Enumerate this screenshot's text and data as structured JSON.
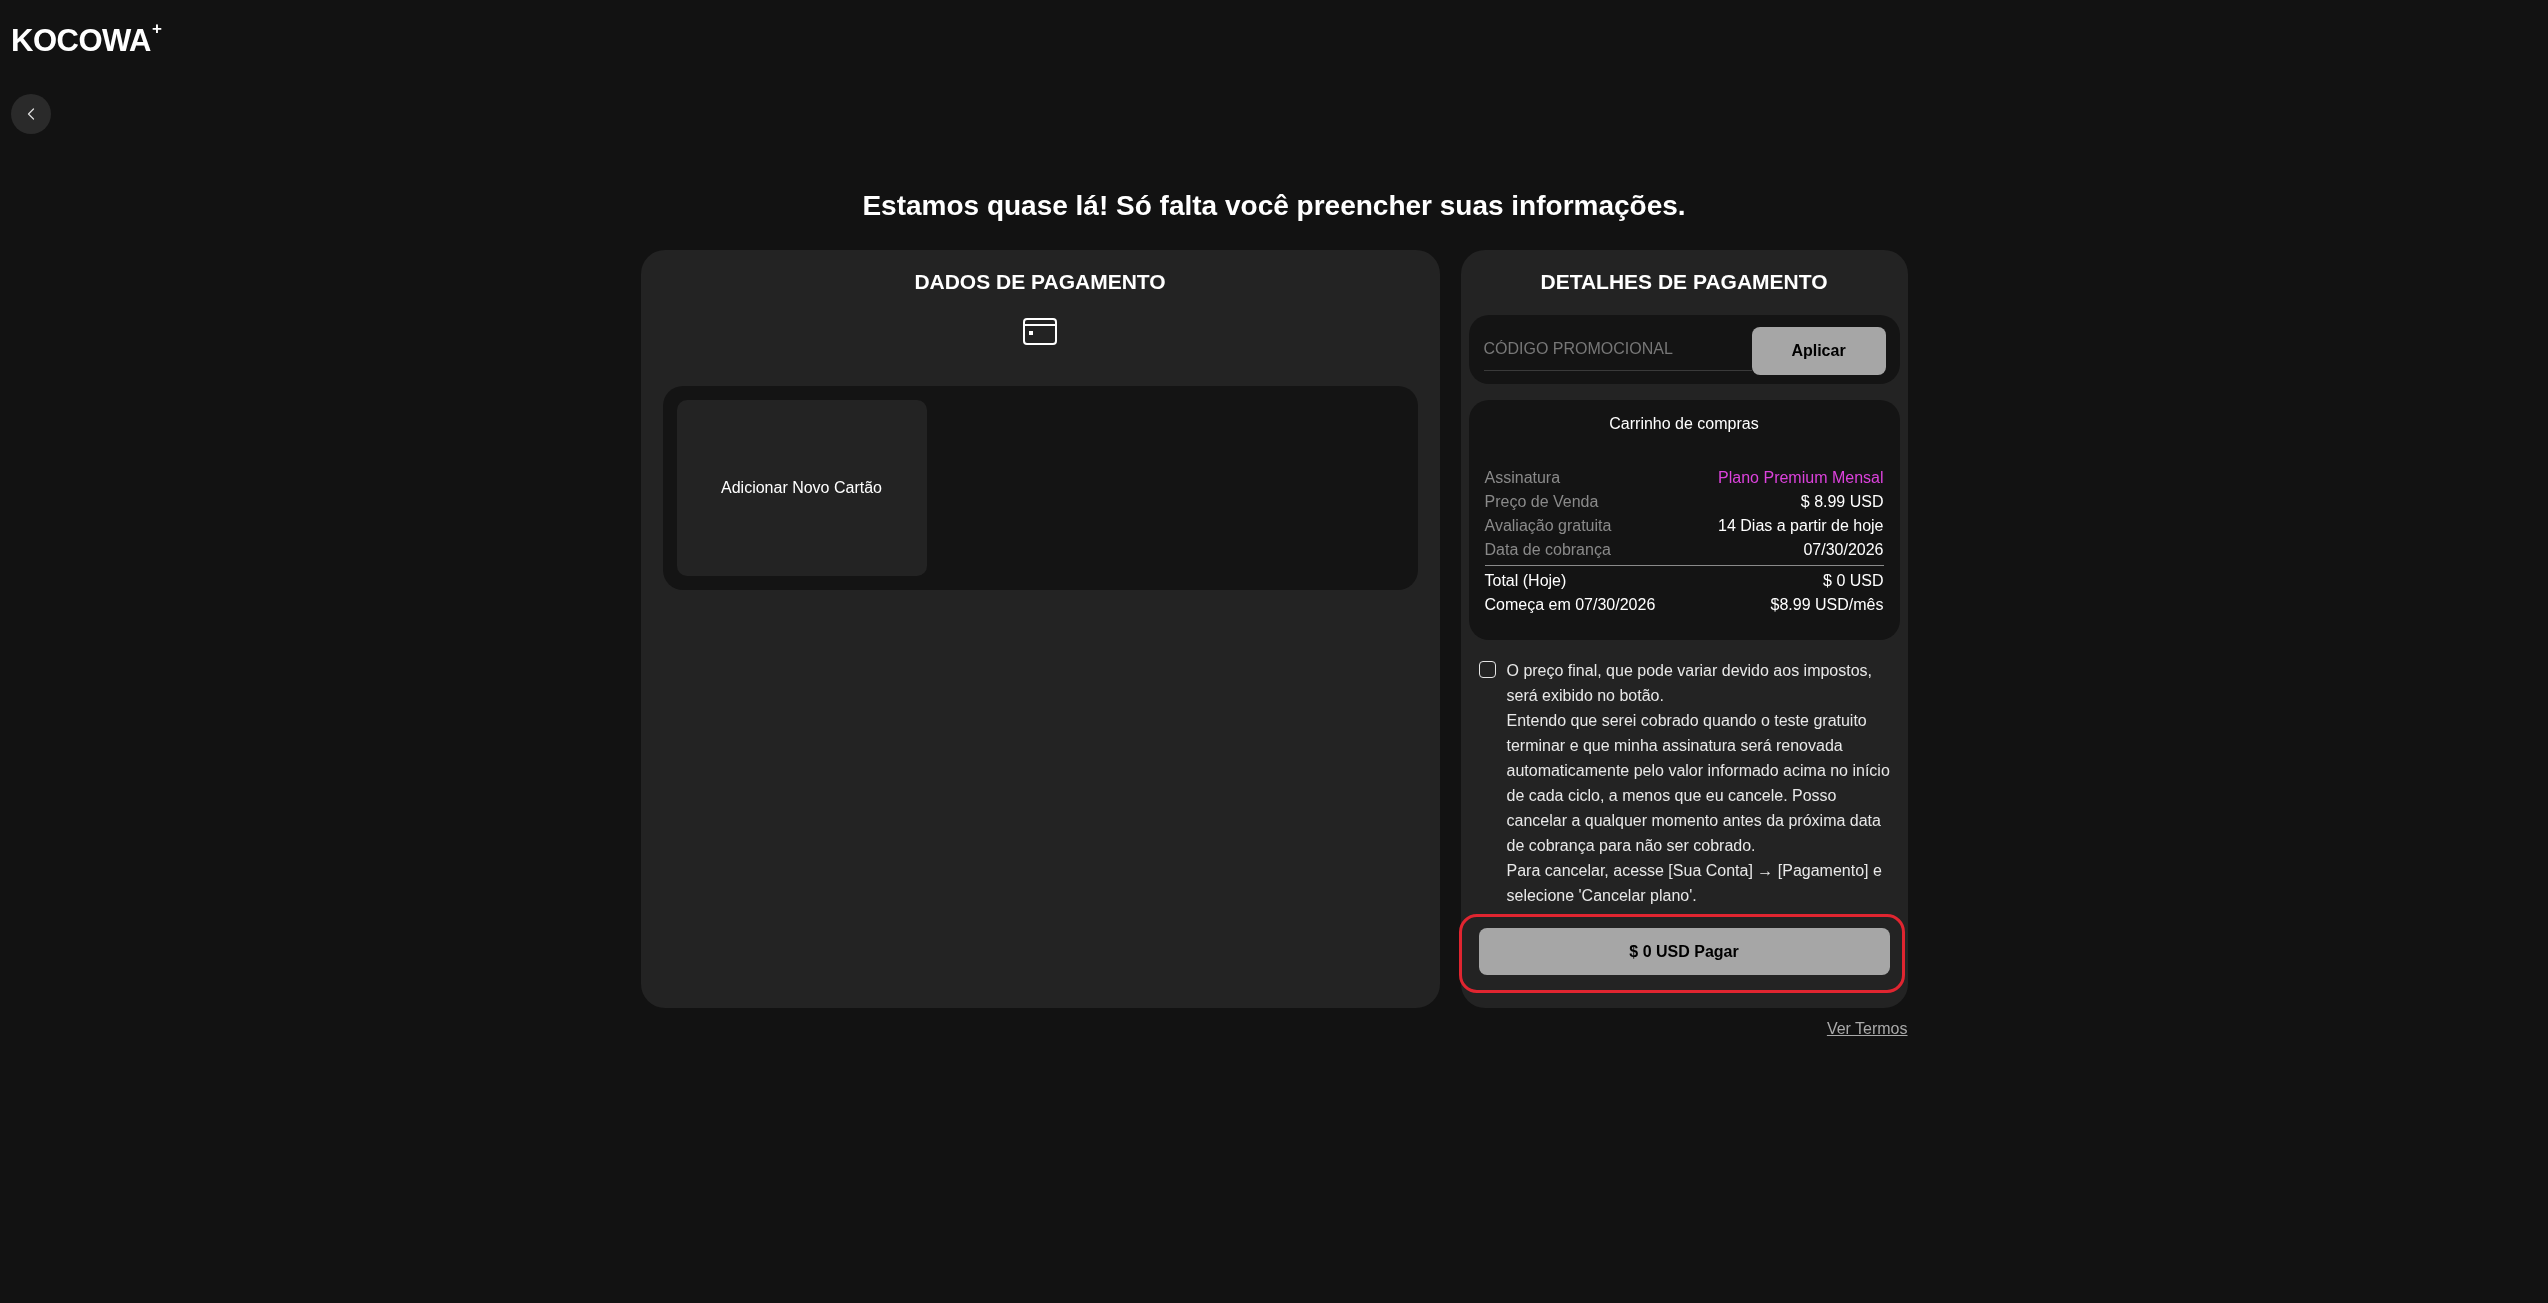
{
  "header": {
    "logo": {
      "text": "KOCOWA",
      "mark": "+"
    }
  },
  "heading": "Estamos quase lá! Só falta você preencher suas informações.",
  "payment_data": {
    "title": "DADOS DE PAGAMENTO",
    "add_card": "Adicionar Novo Cartão"
  },
  "payment_details": {
    "title": "DETALHES DE PAGAMENTO",
    "promo": {
      "placeholder": "CÓDIGO PROMOCIONAL",
      "apply_button": "Aplicar"
    },
    "cart": {
      "title": "Carrinho de compras",
      "items": [
        {
          "label": "Assinatura",
          "value": "Plano Premium Mensal",
          "color": "#dc42dc"
        },
        {
          "label": "Preço de Venda",
          "value": "$ 8.99 USD",
          "color": "#ffffff"
        },
        {
          "label": "Avaliação gratuita",
          "value": "14 Dias a partir de hoje",
          "color": "#ffffff"
        },
        {
          "label": "Data de cobrança",
          "value": "07/30/2026",
          "color": "#ffffff"
        }
      ],
      "totals": [
        {
          "label": "Total (Hoje)",
          "value": "$ 0 USD"
        },
        {
          "label": "Começa em 07/30/2026",
          "value": "$8.99 USD/mês"
        }
      ]
    },
    "consent": {
      "checked": false,
      "paragraphs": [
        "O preço final, que pode variar devido aos impostos, será exibido no botão.",
        "Entendo que serei cobrado quando o teste gratuito terminar e que minha assinatura será renovada automaticamente pelo valor informado acima no início de cada ciclo, a menos que eu cancele. Posso cancelar a qualquer momento antes da próxima data de cobrança para não ser cobrado.",
        "Para cancelar, acesse [Sua Conta] → [Pagamento] e selecione 'Cancelar plano'."
      ]
    },
    "pay_button": {
      "label": "$ 0 USD Pagar",
      "highlighted": true
    }
  },
  "terms_link": "Ver Termos"
}
